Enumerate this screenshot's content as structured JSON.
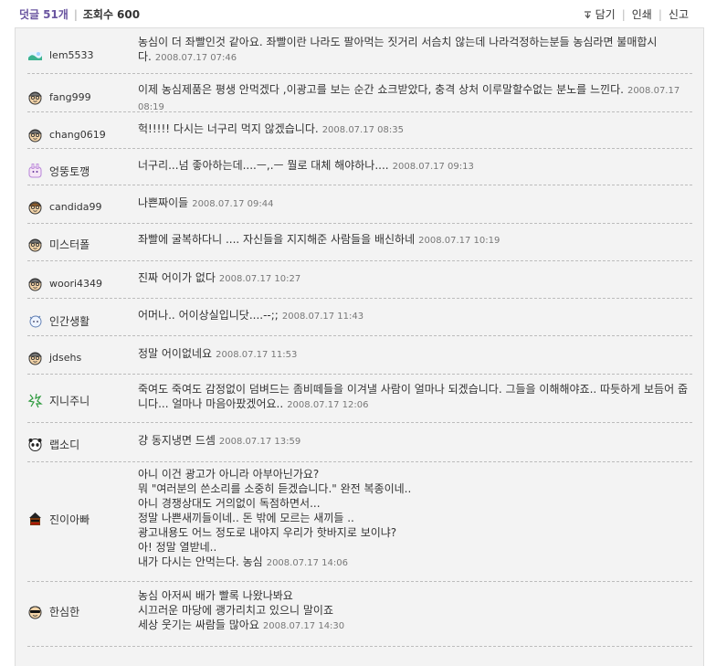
{
  "header": {
    "comment_label": "덧글",
    "comment_count": "51개",
    "views_label": "조회수",
    "views_count": "600",
    "actions": [
      "담기",
      "인쇄",
      "신고"
    ]
  },
  "comments": [
    {
      "user": "lem5533",
      "avatar": "lem5533-icon",
      "text": "농심이 더 좌빨인것 같아요. 좌빨이란 나라도 팔아먹는 짓거리 서슴치 않는데 나라걱정하는분들 농심라면 불매합시다.",
      "date": "2008.07.17 07:46"
    },
    {
      "user": "fang999",
      "avatar": "fang999-icon",
      "text": "이제 농심제품은 평생 안먹겠다 ,이광고를 보는 순간 쇼크받았다, 충격 상처 이루말할수없는 분노를 느낀다.",
      "date": "2008.07.17 08:19"
    },
    {
      "user": "chang0619",
      "avatar": "chang0619-icon",
      "text": "헉!!!!! 다시는 너구리 먹지 않겠습니다.",
      "date": "2008.07.17 08:35"
    },
    {
      "user": "엉뚱토깽",
      "avatar": "엉뚱토깽-icon",
      "text": "너구리...넘 좋아하는데....ㅡ,.ㅡ 뭘로 대체 해야하나....",
      "date": "2008.07.17 09:13"
    },
    {
      "user": "candida99",
      "avatar": "candida99-icon",
      "text": "나쁜짜이들",
      "date": "2008.07.17 09:44"
    },
    {
      "user": "미스터폴",
      "avatar": "미스터폴-icon",
      "text": "좌빨에 굴복하다니 .... 자신들을 지지해준 사람들을 배신하네",
      "date": "2008.07.17 10:19"
    },
    {
      "user": "woori4349",
      "avatar": "woori4349-icon",
      "text": "진짜 어이가 없다",
      "date": "2008.07.17 10:27"
    },
    {
      "user": "인간생활",
      "avatar": "인간생활-icon",
      "text": "어머나.. 어이상실입니닷....--;;",
      "date": "2008.07.17 11:43"
    },
    {
      "user": "jdsehs",
      "avatar": "jdsehs-icon",
      "text": "정말 어이없네요",
      "date": "2008.07.17 11:53"
    },
    {
      "user": "지니주니",
      "avatar": "지니주니-icon",
      "text": "죽여도 죽여도 감정없이 덤벼드는 좀비떼들을 이겨낼 사람이 얼마나 되겠습니다. 그들을 이해해야죠.. 따듯하게 보듬어 줍니다... 얼마나 마음아팠겠어요..",
      "date": "2008.07.17 12:06"
    },
    {
      "user": "랩소디",
      "avatar": "랩소디-icon",
      "text": "걍 동지냉면 드셈",
      "date": "2008.07.17 13:59"
    },
    {
      "user": "진이아빠",
      "avatar": "진이아빠-icon",
      "text": "아니 이건 광고가 아니라 아부아닌가요?\n뭐 \"여러분의 쓴소리를 소중히 듣겠습니다.\" 완전 복종이네..\n아니 경쟁상대도 거의없이 독점하면서...\n정말 나쁜새끼들이네.. 돈 밖에 모르는 새끼들 ..\n광고내용도 어느 정도로 내야지 우리가 핫바지로 보이냐?\n아! 정말 열받네..\n내가 다시는 안먹는다. 농심",
      "date": "2008.07.17 14:06"
    },
    {
      "user": "한심한",
      "avatar": "한심한-icon",
      "text": "농심 아저씨 배가 빨록 나왔나봐요\n시끄러운 마당에 괭가리치고 있으니 말이죠\n세상 웃기는 싸람들 많아요",
      "date": "2008.07.17 14:30"
    }
  ]
}
